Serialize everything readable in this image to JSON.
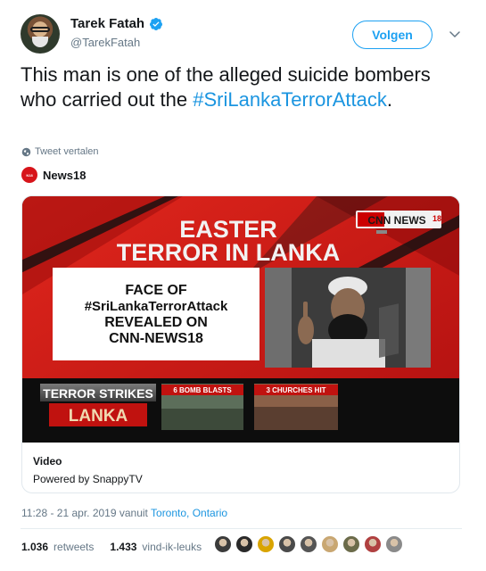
{
  "author": {
    "display_name": "Tarek Fatah",
    "handle": "@TarekFatah",
    "verified_icon": "verified-badge-icon",
    "follow_label": "Volgen"
  },
  "tweet": {
    "text_part1": "This man is one of the alleged suicide bombers who carried out the ",
    "hashtag": "#SriLankaTerrorAttack",
    "text_part2": ".",
    "translate_label": "Tweet vertalen"
  },
  "source": {
    "name": "News18"
  },
  "video_card": {
    "headline_line1": "EASTER",
    "headline_line2": "TERROR IN LANKA",
    "channel_logo": "CNN NEWS18",
    "channel_logo_main": "CNN NEWS",
    "channel_logo_sup": "18",
    "caption_line1": "FACE OF",
    "caption_line2": "#SriLankaTerrorAttack",
    "caption_line3": "REVEALED ON",
    "caption_line4": "CNN-NEWS18",
    "ticker_line1": "TERROR STRIKES",
    "ticker_line2": "LANKA",
    "tag_bombs": "6 BOMB BLASTS",
    "tag_churches": "3 CHURCHES HIT",
    "title": "Video",
    "powered_by": "Powered by SnappyTV"
  },
  "meta": {
    "time": "11:28 - 21 apr. 2019 vanuit ",
    "location": "Toronto, Ontario"
  },
  "stats": {
    "retweets_count": "1.036",
    "retweets_label": "retweets",
    "likes_count": "1.433",
    "likes_label": "vind-ik-leuks"
  },
  "likers": [
    "#3b3b3b",
    "#2a2a2a",
    "#d9a400",
    "#4a4a4a",
    "#555555",
    "#c9a772",
    "#6b6b4a",
    "#b04040",
    "#8a8a8a"
  ],
  "colors": {
    "accent": "#1da1f2",
    "link": "#1b95e0",
    "news_red": "#d7141a"
  }
}
